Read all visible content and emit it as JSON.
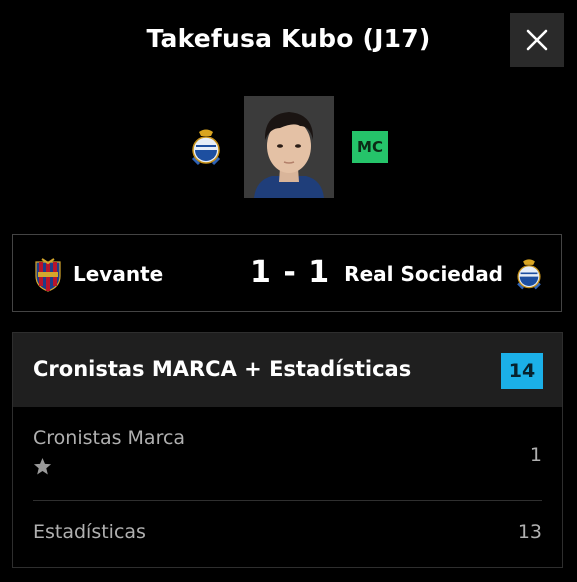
{
  "header": {
    "title": "Takefusa Kubo (J17)",
    "close_icon": "close-icon"
  },
  "player": {
    "team_crest": "real-sociedad-crest-icon",
    "photo": "player-photo",
    "position": "MC",
    "position_color": "#25c46a"
  },
  "match": {
    "home_team": "Levante",
    "home_crest": "levante-crest-icon",
    "score": "1 - 1",
    "away_team": "Real Sociedad",
    "away_crest": "real-sociedad-crest-icon"
  },
  "ratings": {
    "title": "Cronistas MARCA + Estadísticas",
    "total": "14",
    "total_color": "#1bb0e8",
    "rows": [
      {
        "label": "Cronistas Marca",
        "value": "1",
        "stars": 1,
        "star_icon": "star-icon"
      },
      {
        "label": "Estadísticas",
        "value": "13"
      }
    ]
  }
}
